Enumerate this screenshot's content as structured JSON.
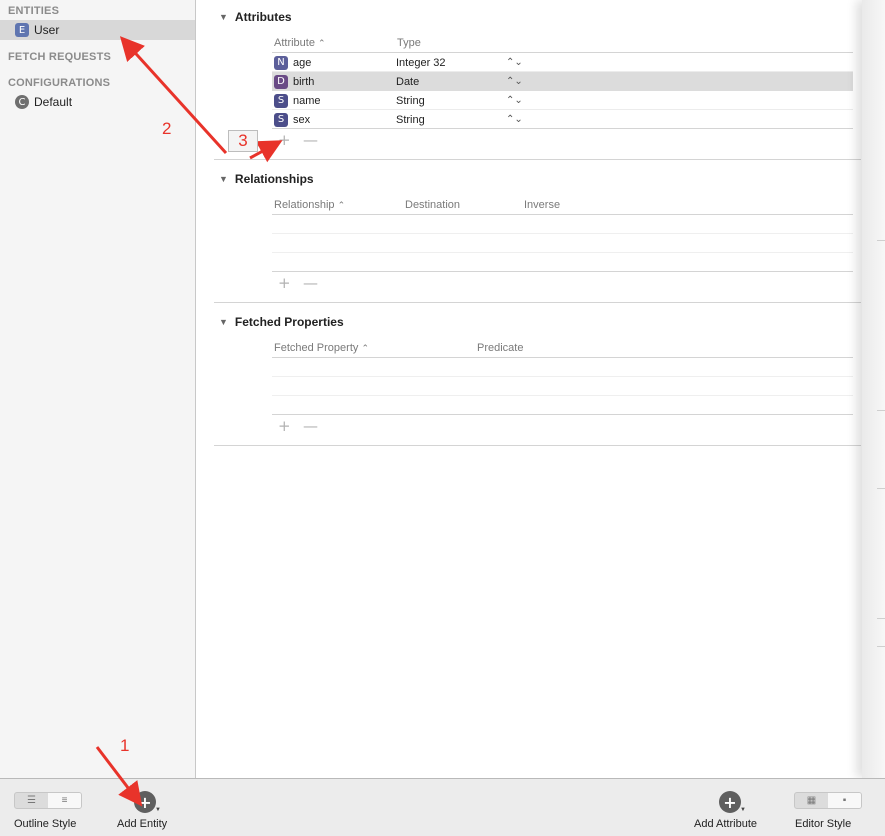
{
  "sidebar": {
    "entities_header": "ENTITIES",
    "entity_user": {
      "badge": "E",
      "label": "User"
    },
    "fetch_requests_header": "FETCH REQUESTS",
    "configurations_header": "CONFIGURATIONS",
    "config_default": {
      "badge": "C",
      "label": "Default"
    }
  },
  "attributes": {
    "title": "Attributes",
    "col_attribute": "Attribute",
    "col_type": "Type",
    "rows": [
      {
        "badge": "N",
        "name": "age",
        "type": "Integer 32"
      },
      {
        "badge": "D",
        "name": "birth",
        "type": "Date"
      },
      {
        "badge": "S",
        "name": "name",
        "type": "String"
      },
      {
        "badge": "S",
        "name": "sex",
        "type": "String"
      }
    ]
  },
  "relationships": {
    "title": "Relationships",
    "col_relationship": "Relationship",
    "col_destination": "Destination",
    "col_inverse": "Inverse"
  },
  "fetched_properties": {
    "title": "Fetched Properties",
    "col_fetched_property": "Fetched Property",
    "col_predicate": "Predicate"
  },
  "controls": {
    "plus": "+",
    "minus": "—",
    "sort_up": "⌃",
    "stepper": "⌃⌄"
  },
  "bottombar": {
    "outline_style_label": "Outline Style",
    "add_entity_label": "Add Entity",
    "add_attribute_label": "Add Attribute",
    "editor_style_label": "Editor Style"
  },
  "annotations": {
    "n1": "1",
    "n2": "2",
    "n3": "3"
  },
  "colors": {
    "annotation": "#e8332a",
    "selection": "#d8d8d8"
  }
}
